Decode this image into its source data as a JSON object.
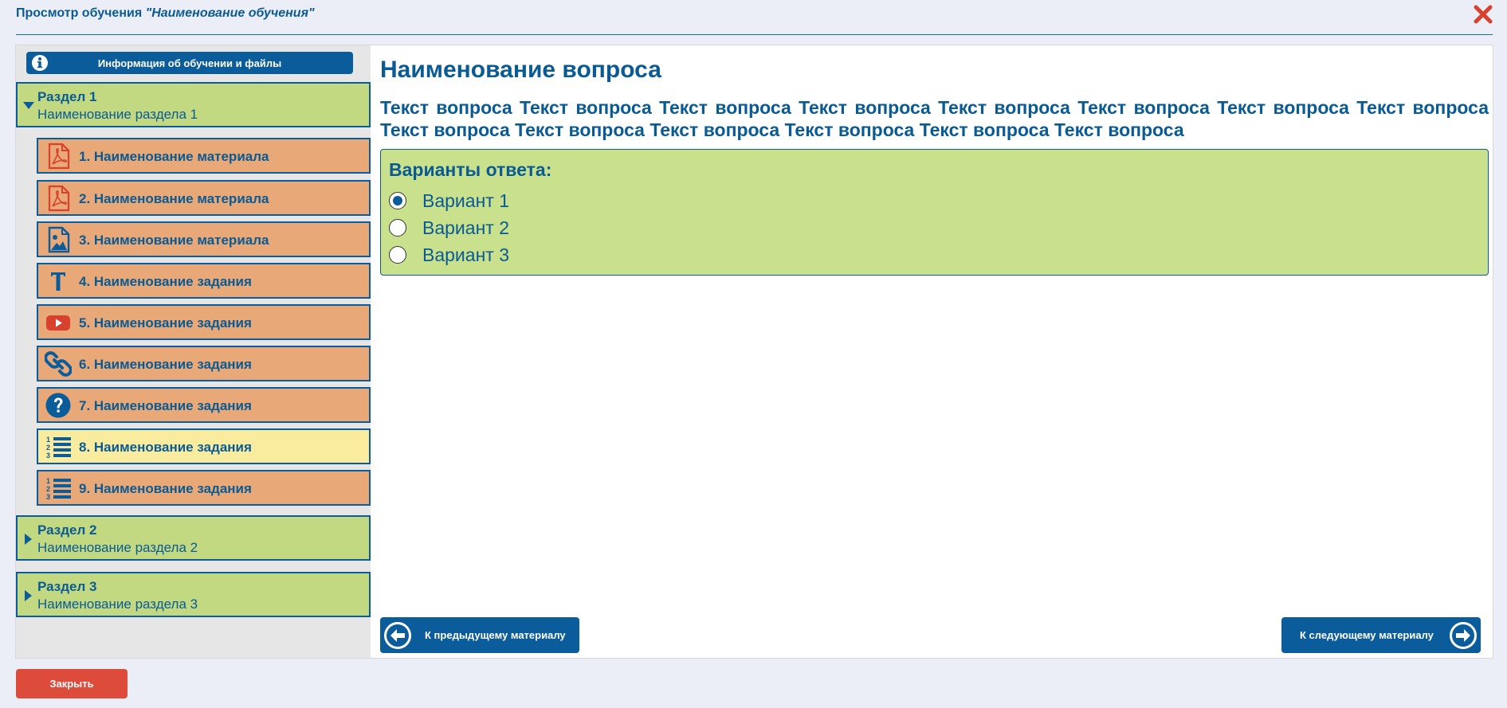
{
  "window": {
    "title_prefix": "Просмотр обучения ",
    "title_name": "\"Наименование обучения\""
  },
  "sidebar": {
    "info_button_label": "Информация об обучении и файлы",
    "sections": [
      {
        "title": "Раздел 1",
        "name": "Наименование раздела 1",
        "expanded": true,
        "items": [
          {
            "label": "1. Наименование материала",
            "icon": "pdf-icon",
            "active": false
          },
          {
            "label": "2. Наименование материала",
            "icon": "pdf-icon",
            "active": false
          },
          {
            "label": "3. Наименование материала",
            "icon": "image-icon",
            "active": false
          },
          {
            "label": "4. Наименование задания",
            "icon": "text-icon",
            "active": false
          },
          {
            "label": "5. Наименование задания",
            "icon": "youtube-icon",
            "active": false
          },
          {
            "label": "6. Наименование задания",
            "icon": "link-icon",
            "active": false
          },
          {
            "label": "7. Наименование задания",
            "icon": "question-icon",
            "active": false
          },
          {
            "label": "8. Наименование задания",
            "icon": "numbered-list-icon",
            "active": true
          },
          {
            "label": "9. Наименование задания",
            "icon": "numbered-list-icon",
            "active": false
          }
        ]
      },
      {
        "title": "Раздел 2",
        "name": "Наименование раздела 2",
        "expanded": false
      },
      {
        "title": "Раздел 3",
        "name": "Наименование раздела 3",
        "expanded": false
      }
    ]
  },
  "question": {
    "title": "Наименование вопроса",
    "text": "Текст вопроса Текст вопроса Текст вопроса Текст вопроса Текст вопроса Текст вопроса Текст вопроса Текст вопроса Текст вопроса Текст вопроса Текст вопроса Текст вопроса Текст вопроса Текст вопроса",
    "answers_title": "Варианты ответа:",
    "options": [
      {
        "label": "Вариант 1",
        "selected": true
      },
      {
        "label": "Вариант 2",
        "selected": false
      },
      {
        "label": "Вариант 3",
        "selected": false
      }
    ]
  },
  "navigation": {
    "prev_label": "К предыдущему материалу",
    "next_label": "К следующему материалу"
  },
  "footer": {
    "close_label": "Закрыть"
  },
  "colors": {
    "primary": "#0b5c9a",
    "section_bg": "#c2d981",
    "item_bg": "#e8a877",
    "active_item_bg": "#f9ec9f",
    "answers_bg": "#c9e08d",
    "danger": "#dd4b3a",
    "close_icon": "#d9412f"
  }
}
